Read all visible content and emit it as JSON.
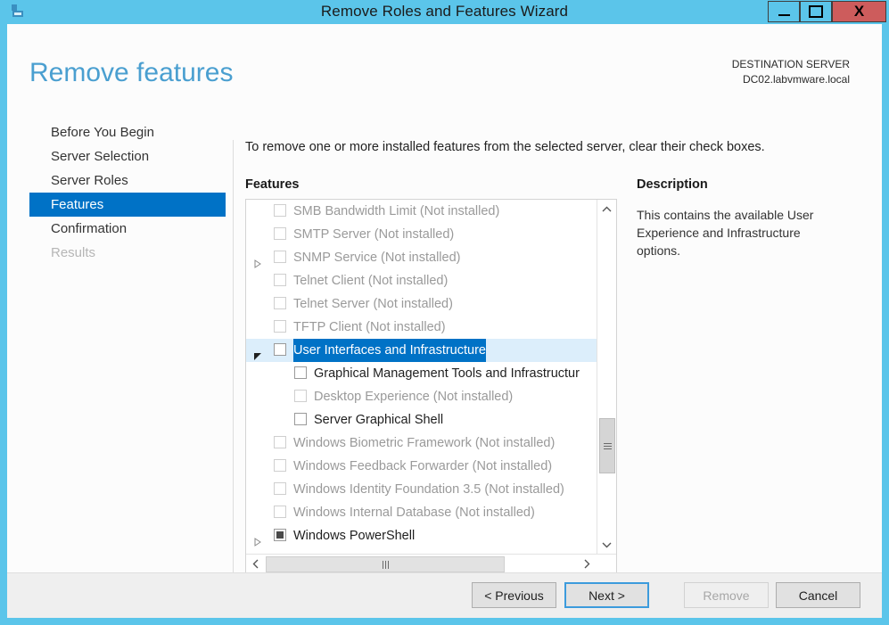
{
  "window": {
    "title": "Remove Roles and Features Wizard",
    "icon": "server-icon",
    "controls": {
      "minimize": "minimize-icon",
      "maximize": "maximize-icon",
      "close": "X"
    }
  },
  "header": {
    "page_title": "Remove features",
    "destination_label": "DESTINATION SERVER",
    "destination_server": "DC02.labvmware.local"
  },
  "sidebar": {
    "items": [
      {
        "label": "Before You Begin",
        "state": "normal"
      },
      {
        "label": "Server Selection",
        "state": "normal"
      },
      {
        "label": "Server Roles",
        "state": "normal"
      },
      {
        "label": "Features",
        "state": "active"
      },
      {
        "label": "Confirmation",
        "state": "normal"
      },
      {
        "label": "Results",
        "state": "disabled"
      }
    ]
  },
  "main": {
    "instruction": "To remove one or more installed features from the selected server, clear their check boxes.",
    "features_label": "Features",
    "description_label": "Description",
    "description_text": "This contains the available User Experience and Infrastructure options.",
    "tree": [
      {
        "label": "SMB Bandwidth Limit (Not installed)",
        "level": 1,
        "dim": true,
        "checkbox": "empty",
        "expander": "none",
        "selected": false
      },
      {
        "label": "SMTP Server (Not installed)",
        "level": 1,
        "dim": true,
        "checkbox": "empty",
        "expander": "none",
        "selected": false
      },
      {
        "label": "SNMP Service (Not installed)",
        "level": 1,
        "dim": true,
        "checkbox": "empty",
        "expander": "collapsed",
        "selected": false
      },
      {
        "label": "Telnet Client (Not installed)",
        "level": 1,
        "dim": true,
        "checkbox": "empty",
        "expander": "none",
        "selected": false
      },
      {
        "label": "Telnet Server (Not installed)",
        "level": 1,
        "dim": true,
        "checkbox": "empty",
        "expander": "none",
        "selected": false
      },
      {
        "label": "TFTP Client (Not installed)",
        "level": 1,
        "dim": true,
        "checkbox": "empty",
        "expander": "none",
        "selected": false
      },
      {
        "label": "User Interfaces and Infrastructure",
        "level": 1,
        "dim": false,
        "checkbox": "empty",
        "expander": "expanded",
        "selected": true
      },
      {
        "label": "Graphical Management Tools and Infrastructur",
        "level": 2,
        "dim": false,
        "checkbox": "empty",
        "expander": "none",
        "selected": false
      },
      {
        "label": "Desktop Experience (Not installed)",
        "level": 2,
        "dim": true,
        "checkbox": "empty",
        "expander": "none",
        "selected": false
      },
      {
        "label": "Server Graphical Shell",
        "level": 2,
        "dim": false,
        "checkbox": "empty",
        "expander": "none",
        "selected": false
      },
      {
        "label": "Windows Biometric Framework (Not installed)",
        "level": 1,
        "dim": true,
        "checkbox": "empty",
        "expander": "none",
        "selected": false
      },
      {
        "label": "Windows Feedback Forwarder (Not installed)",
        "level": 1,
        "dim": true,
        "checkbox": "empty",
        "expander": "none",
        "selected": false
      },
      {
        "label": "Windows Identity Foundation 3.5 (Not installed)",
        "level": 1,
        "dim": true,
        "checkbox": "empty",
        "expander": "none",
        "selected": false
      },
      {
        "label": "Windows Internal Database (Not installed)",
        "level": 1,
        "dim": true,
        "checkbox": "empty",
        "expander": "none",
        "selected": false
      },
      {
        "label": "Windows PowerShell",
        "level": 1,
        "dim": false,
        "checkbox": "indeterminate",
        "expander": "collapsed",
        "selected": false
      }
    ],
    "scrollbars": {
      "vertical_up": "▲",
      "vertical_down": "▼",
      "horizontal_left": "‹",
      "horizontal_right": "›"
    }
  },
  "footer": {
    "previous": "< Previous",
    "next": "Next >",
    "remove": "Remove",
    "cancel": "Cancel"
  },
  "colors": {
    "accent": "#5bc5ea",
    "title": "#4a9fd0",
    "selection": "#0072c6",
    "close": "#cd5c5c"
  }
}
